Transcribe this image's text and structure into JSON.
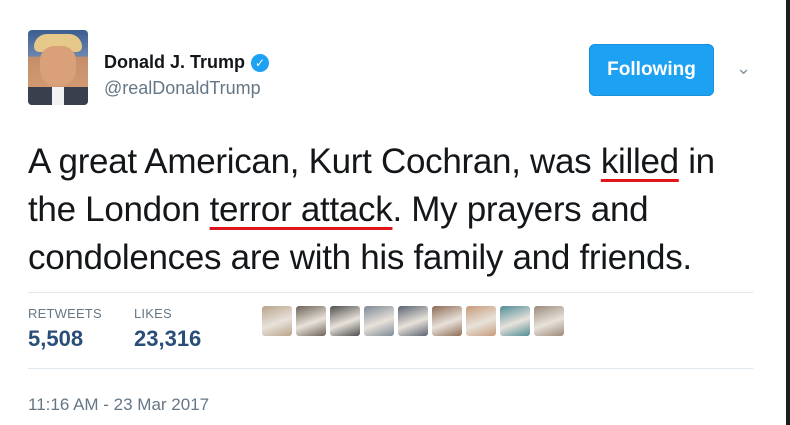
{
  "header": {
    "display_name": "Donald J. Trump",
    "handle": "@realDonaldTrump",
    "verified_icon": "verified-badge-icon",
    "follow_label": "Following",
    "menu_icon": "chevron-down-icon"
  },
  "tweet": {
    "line1_a": "A great American, Kurt Cochran, was ",
    "line1_b": "killed",
    "line1_c": " in",
    "line2_a": "the London ",
    "line2_b": "terror attack",
    "line2_c": ". My prayers and",
    "line3": "condolences are with his family and friends."
  },
  "stats": {
    "retweets_label": "RETWEETS",
    "retweets_value": "5,508",
    "likes_label": "LIKES",
    "likes_value": "23,316"
  },
  "likers": [
    {
      "name": "liker-avatar",
      "color": "#b9a48c"
    },
    {
      "name": "liker-avatar",
      "color": "#6d6356"
    },
    {
      "name": "liker-avatar",
      "color": "#4f4f4f"
    },
    {
      "name": "liker-avatar",
      "color": "#7d8a96"
    },
    {
      "name": "liker-avatar",
      "color": "#5a6370"
    },
    {
      "name": "liker-avatar",
      "color": "#8e6b55"
    },
    {
      "name": "liker-avatar",
      "color": "#c79a7a"
    },
    {
      "name": "liker-avatar",
      "color": "#4e8c96"
    },
    {
      "name": "liker-avatar",
      "color": "#9b8a7a"
    }
  ],
  "timestamp": "11:16 AM - 23 Mar 2017",
  "colors": {
    "accent": "#1da1f2",
    "underline": "#e0151b",
    "stat_value": "#2a4e7a",
    "muted": "#657786"
  }
}
